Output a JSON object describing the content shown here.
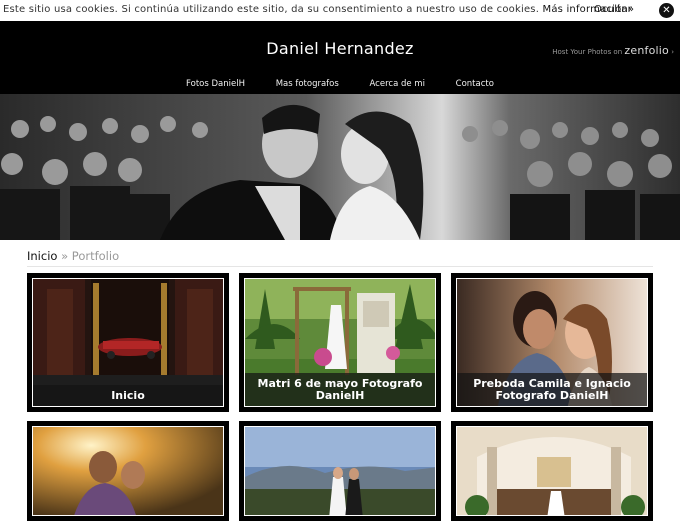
{
  "cookie_bar": {
    "message": "Este sitio usa cookies. Si continúa utilizando este sitio, da su consentimiento a nuestro uso de cookies.",
    "more_info": "Más información»",
    "hide": "Ocultar",
    "close_icon": "close-icon"
  },
  "header": {
    "site_title": "Daniel Hernandez",
    "host_prefix": "Host Your Photos on",
    "host_brand": "zenfolio",
    "host_suffix": "›"
  },
  "nav": [
    {
      "label": "Fotos DanielH"
    },
    {
      "label": "Mas fotografos"
    },
    {
      "label": "Acerca de mi"
    },
    {
      "label": "Contacto"
    }
  ],
  "breadcrumb": {
    "home": "Inicio",
    "separator": "»",
    "current": "Portfolio"
  },
  "galleries": [
    {
      "title": "Inicio"
    },
    {
      "title": "Matri 6 de mayo Fotografo DanielH"
    },
    {
      "title": "Preboda Camila e Ignacio Fotografo DanielH"
    },
    {
      "title": ""
    },
    {
      "title": ""
    },
    {
      "title": ""
    }
  ]
}
